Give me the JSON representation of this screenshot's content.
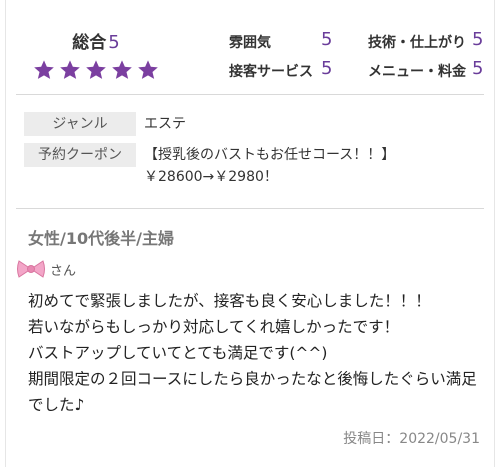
{
  "rating": {
    "overall_label": "総合",
    "overall_value": "5",
    "stars": 5,
    "atmosphere_label": "雰囲気",
    "atmosphere_value": "5",
    "technique_label": "技術・仕上がり",
    "technique_value": "5",
    "service_label": "接客サービス",
    "service_value": "5",
    "menu_label": "メニュー・料金",
    "menu_value": "5"
  },
  "info": {
    "genre_key": "ジャンル",
    "genre_value": "エステ",
    "coupon_key": "予約クーポン",
    "coupon_value": "【授乳後のバストもお任せコース！！】￥28600→￥2980！"
  },
  "reviewer": {
    "profile": "女性/10代後半/主婦",
    "nickname": "さん"
  },
  "review": {
    "lines": [
      "初めてで緊張しましたが、接客も良く安心しました！！！",
      "若いながらもしっかり対応してくれ嬉しかったです！",
      "バストアップしていてとても満足です(^^)",
      "期間限定の２回コースにしたら良かったなと後悔したぐらい満足でした♪"
    ],
    "posted": "投稿日：2022/05/31"
  },
  "colors": {
    "accent": "#7b3fa0",
    "label_bg": "#ececec",
    "ribbon": "#f3a6c8"
  }
}
